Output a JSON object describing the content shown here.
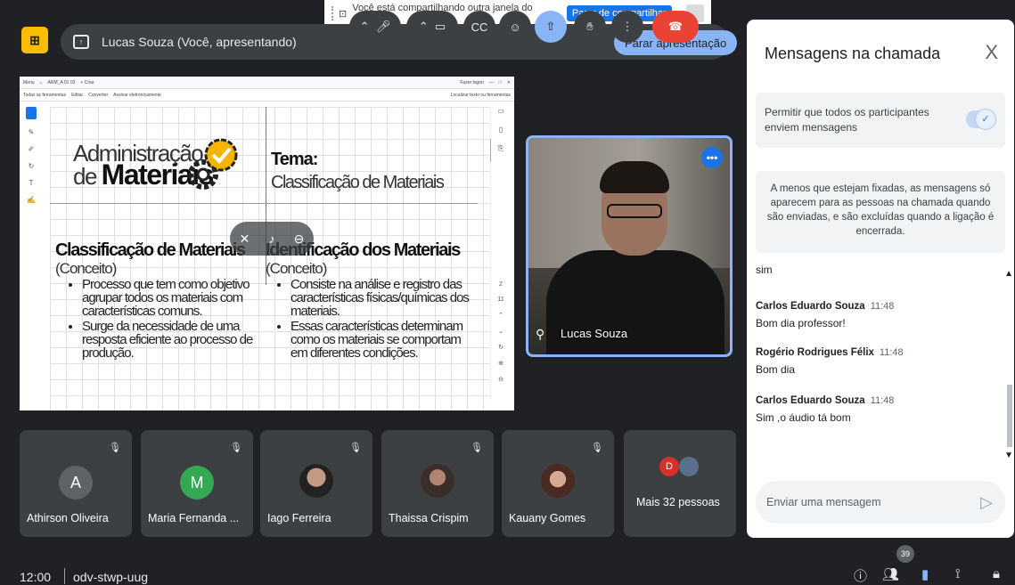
{
  "share_banner": {
    "text": "Você está compartilhando outra janela do aplicativo.",
    "stop_label": "Parar de compartilhar",
    "minimize_label": "_"
  },
  "presenter": {
    "name": "Lucas Souza (Você, apresentando)",
    "stop_label": "Parar apresentação"
  },
  "pdf": {
    "menu_text": "Menu",
    "file_name": "ARM_A 01 02",
    "new_tab": "+ Criar",
    "login": "Fazer logon",
    "tools_text": "Todas as ferramentas",
    "edit_text": "Editar",
    "convert_text": "Converter",
    "sign_text": "Assinar eletronicamente",
    "search_text": "Localizar texto ou ferramentas",
    "page_number": "2",
    "page_total": "11"
  },
  "slide": {
    "title_line1": "Administração",
    "title_line2_prefix": "de",
    "title_line2_bold": "Materiais",
    "tema_label": "Tema:",
    "tema_value": "Classificação de Materiais",
    "col1_heading": "Classificação de Materiais",
    "col1_sub": "(Conceito)",
    "col1_bullets": [
      "Processo que tem como objetivo agrupar todos os materiais com características comuns.",
      "Surge da necessidade de uma resposta eficiente ao processo de produção."
    ],
    "col2_heading": "Identificação dos Materiais",
    "col2_sub": "(Conceito)",
    "col2_bullets": [
      "Consiste na análise e registro das características físicas/químicas dos materiais.",
      "Essas características determinam como os materiais se comportam em diferentes condições."
    ]
  },
  "self_tile": {
    "name": "Lucas Souza"
  },
  "participants": [
    {
      "name": "Athirson Oliveira",
      "initial": "A",
      "color": "#5f6368"
    },
    {
      "name": "Maria Fernanda ...",
      "initial": "M",
      "color": "#34a853"
    },
    {
      "name": "Iago Ferreira",
      "initial": "",
      "color": "#3c4043"
    },
    {
      "name": "Thaissa Crispim",
      "initial": "",
      "color": "#3c4043"
    },
    {
      "name": "Kauany Gomes",
      "initial": "",
      "color": "#3c4043"
    }
  ],
  "more_people": {
    "label": "Mais 32 pessoas",
    "initial": "D"
  },
  "bottom_bar": {
    "time": "12:00",
    "meeting_code": "odv-stwp-uug",
    "participant_count": "39"
  },
  "chat": {
    "title": "Mensagens na chamada",
    "close_label": "X",
    "permission_text": "Permitir que todos os participantes enviem mensagens",
    "info_text": "A menos que estejam fixadas, as mensagens só aparecem para as pessoas na chamada quando são enviadas, e são excluídas quando a ligação é encerrada.",
    "messages": [
      {
        "sender": "",
        "time": "",
        "text": "sim"
      },
      {
        "sender": "Carlos Eduardo Souza",
        "time": "11:48",
        "text": "Bom dia professor!"
      },
      {
        "sender": "Rogério Rodrigues Félix",
        "time": "11:48",
        "text": "Bom dia"
      },
      {
        "sender": "Carlos Eduardo Souza",
        "time": "11:48",
        "text": "Sim ,o áudio  tá bom"
      }
    ],
    "input_placeholder": "Enviar uma mensagem"
  },
  "colors": {
    "background": "#202124",
    "accent_blue": "#8ab4f8",
    "brand_yellow": "#fbbc04",
    "end_call_red": "#ea4335"
  }
}
